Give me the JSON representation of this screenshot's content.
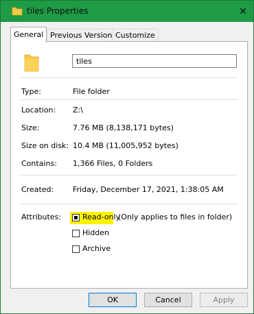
{
  "window": {
    "title": "tiles Properties",
    "close_glyph": "✕"
  },
  "tabs": [
    {
      "label": "General",
      "active": true
    },
    {
      "label": "Previous Versions",
      "active": false
    },
    {
      "label": "Customize",
      "active": false
    }
  ],
  "general": {
    "name_value": "tiles",
    "fields": {
      "type": {
        "label": "Type:",
        "value": "File folder"
      },
      "location": {
        "label": "Location:",
        "value": "Z:\\"
      },
      "size": {
        "label": "Size:",
        "value": "7.76 MB (8,138,171 bytes)"
      },
      "size_on_disk": {
        "label": "Size on disk:",
        "value": "10.4 MB (11,005,952 bytes)"
      },
      "contains": {
        "label": "Contains:",
        "value": "1,366 Files, 0 Folders"
      },
      "created": {
        "label": "Created:",
        "value": "Friday, December 17, 2021, 1:38:05 AM"
      }
    },
    "attributes": {
      "label": "Attributes:",
      "read_only": {
        "label": "Read-only",
        "note": "(Only applies to files in folder)",
        "state": "indeterminate"
      },
      "hidden": {
        "label": "Hidden",
        "state": "unchecked"
      },
      "archive": {
        "label": "Archive",
        "state": "unchecked"
      }
    }
  },
  "buttons": {
    "ok": "OK",
    "cancel": "Cancel",
    "apply": "Apply"
  },
  "colors": {
    "titlebar": "#1f9a45",
    "highlight": "#fff200",
    "folder": "#f7c948"
  },
  "icons": {
    "title": "folder-icon",
    "large": "folder-large-icon"
  }
}
